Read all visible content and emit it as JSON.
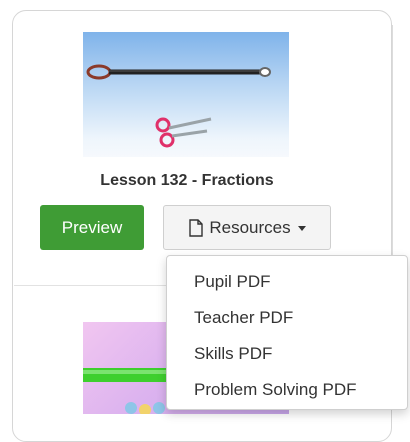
{
  "lesson": {
    "title": "Lesson 132 - Fractions",
    "preview_label": "Preview",
    "resources_label": "Resources"
  },
  "resources_menu": {
    "items": [
      {
        "label": "Pupil PDF"
      },
      {
        "label": "Teacher PDF"
      },
      {
        "label": "Skills PDF"
      },
      {
        "label": "Problem Solving PDF"
      }
    ]
  },
  "icons": {
    "resources": "document-icon",
    "dropdown": "caret-down-icon",
    "thumbnail": "scissors-icon"
  },
  "colors": {
    "preview_button": "#3f9c35",
    "dropdown_border": "#cfcfcf"
  }
}
